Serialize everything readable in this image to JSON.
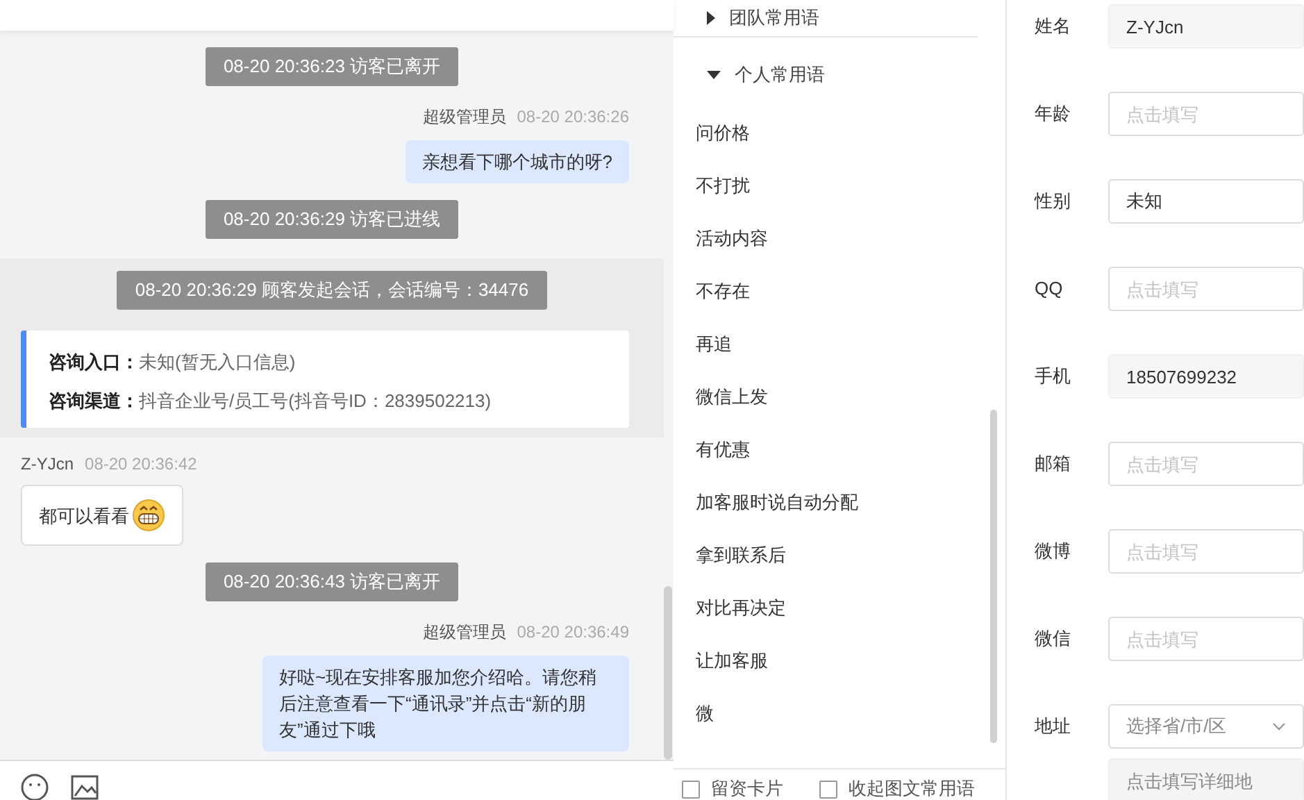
{
  "chat": {
    "messages": [
      {
        "kind": "system",
        "text": "08-20 20:36:23 访客已离开"
      },
      {
        "kind": "agent",
        "name": "超级管理员",
        "time": "08-20 20:36:26",
        "text": "亲想看下哪个城市的呀?"
      },
      {
        "kind": "system",
        "text": "08-20 20:36:29 访客已进线"
      },
      {
        "kind": "session",
        "text": "08-20 20:36:29 顾客发起会话，会话编号：34476",
        "info": [
          {
            "label": "咨询入口：",
            "value": "未知(暂无入口信息)"
          },
          {
            "label": "咨询渠道：",
            "value": "抖音企业号/员工号(抖音号ID：2839502213)"
          }
        ]
      },
      {
        "kind": "customer",
        "name": "Z-YJcn",
        "time": "08-20 20:36:42",
        "text": "都可以看看",
        "emoji": true
      },
      {
        "kind": "system",
        "text": "08-20 20:36:43 访客已离开"
      },
      {
        "kind": "agent",
        "name": "超级管理员",
        "time": "08-20 20:36:49",
        "text": "好哒~现在安排客服加您介绍哈。请您稍后注意查看一下“通讯录”并点击“新的朋友”通过下哦"
      }
    ]
  },
  "phrases": {
    "groups": [
      {
        "label": "团队常用语",
        "expanded": false
      },
      {
        "label": "个人常用语",
        "expanded": true,
        "items": [
          "问价格",
          "不打扰",
          "活动内容",
          "不存在",
          "再追",
          "微信上发",
          "有优惠",
          "加客服时说自动分配",
          "拿到联系后",
          "对比再决定",
          "让加客服",
          "微"
        ]
      }
    ],
    "options": [
      {
        "label": "留资卡片",
        "checked": false
      },
      {
        "label": "收起图文常用语",
        "checked": false
      }
    ]
  },
  "profile": {
    "fields": [
      {
        "kind": "text",
        "label": "姓名",
        "value": "Z-YJcn",
        "readonly": true
      },
      {
        "kind": "text",
        "label": "年龄",
        "placeholder": "点击填写",
        "readonly": false
      },
      {
        "kind": "text",
        "label": "性别",
        "value": "未知",
        "readonly": false
      },
      {
        "kind": "text",
        "label": "QQ",
        "placeholder": "点击填写",
        "readonly": false
      },
      {
        "kind": "text",
        "label": "手机",
        "value": "18507699232",
        "readonly": true
      },
      {
        "kind": "text",
        "label": "邮箱",
        "placeholder": "点击填写",
        "readonly": false
      },
      {
        "kind": "text",
        "label": "微博",
        "placeholder": "点击填写",
        "readonly": false
      },
      {
        "kind": "text",
        "label": "微信",
        "placeholder": "点击填写",
        "readonly": false
      },
      {
        "kind": "address",
        "label": "地址",
        "placeholder": "选择省/市/区",
        "detail_placeholder": "点击填写详细地"
      }
    ]
  }
}
